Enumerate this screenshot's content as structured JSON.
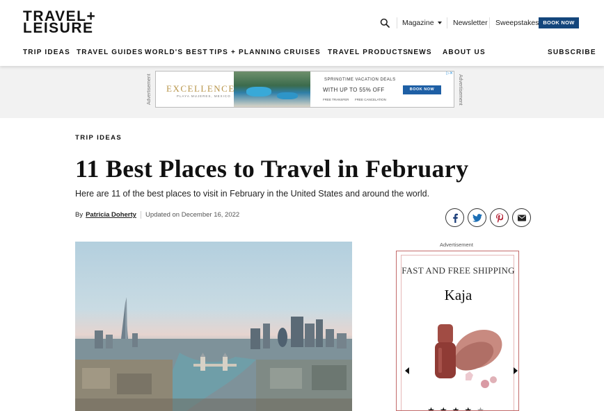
{
  "header": {
    "logo_line1": "TRAVEL+",
    "logo_line2": "LEISURE",
    "magazine_label": "Magazine",
    "newsletter_label": "Newsletter",
    "sweepstakes_label": "Sweepstakes",
    "book_now_label": "BOOK NOW",
    "search_icon": "search-icon"
  },
  "nav": {
    "items": [
      "TRIP IDEAS",
      "TRAVEL GUIDES",
      "WORLD'S BEST",
      "TIPS + PLANNING",
      "CRUISES",
      "TRAVEL PRODUCTS",
      "NEWS",
      "ABOUT US"
    ],
    "subscribe_label": "SUBSCRIBE"
  },
  "banner_ad": {
    "side_label": "Advertisement",
    "brand": "EXCELLENCE",
    "brand_sub": "PLAYA MUJERES, MEXICO",
    "headline": "SPRINGTIME VACATION DEALS",
    "offer": "WITH UP TO 55% OFF",
    "button": "BOOK NOW",
    "feature1": "FREE TRANSFER",
    "feature2": "FREE CANCELATION"
  },
  "article": {
    "kicker": "TRIP IDEAS",
    "title": "11 Best Places to Travel in February",
    "dek": "Here are 11 of the best places to visit in February in the United States and around the world.",
    "by_label": "By",
    "author": "Patricia Doherty",
    "updated": "Updated on December 16, 2022"
  },
  "social": [
    "facebook-icon",
    "twitter-icon",
    "pinterest-icon",
    "email-icon"
  ],
  "side_ad": {
    "label": "Advertisement",
    "headline": "FAST AND FREE SHIPPING",
    "brand": "Kaja",
    "rating": 4,
    "rating_max": 5
  },
  "colors": {
    "book_button": "#14467c",
    "banner_button": "#1e5fa5",
    "ad_border": "#c26a6a"
  }
}
